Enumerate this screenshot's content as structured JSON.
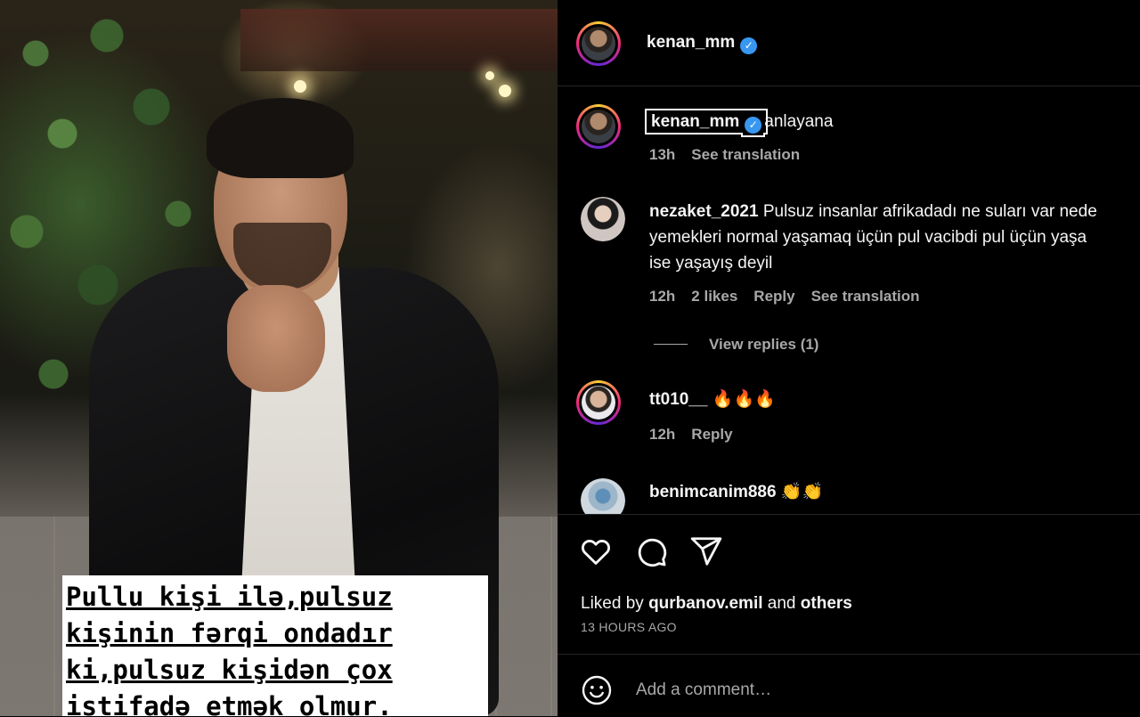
{
  "post_image": {
    "overlay_lines": [
      "Pullu kişi ilə,pulsuz",
      "kişinin fərqi ondadır",
      "ki,pulsuz kişidən çox",
      "istifadə etmək olmur."
    ]
  },
  "header": {
    "username": "kenan_mm",
    "verified_icon": "verified-badge-icon"
  },
  "caption": {
    "username": "kenan_mm",
    "text": "anlayana",
    "time": "13h",
    "see_translation": "See translation"
  },
  "comments": [
    {
      "username": "nezaket_2021",
      "line1": "Pulsuz insanlar afrikadadı ne suları var nede",
      "line2": "yemekleri normal yaşamaq üçün pul vacibdi pul üçün yaşa",
      "line3": "ise yaşayış deyil",
      "time": "12h",
      "likes": "2 likes",
      "reply": "Reply",
      "see_translation": "See translation",
      "view_replies": "View replies (1)"
    },
    {
      "username": "tt010__",
      "text": "🔥🔥🔥",
      "time": "12h",
      "reply": "Reply"
    },
    {
      "username": "benimcanim886",
      "text": "👏👏"
    }
  ],
  "actions": {
    "like_icon": "heart-icon",
    "comment_icon": "comment-icon",
    "share_icon": "send-icon"
  },
  "likes": {
    "prefix": "Liked by",
    "user": "qurbanov.emil",
    "and": "and",
    "others": "others"
  },
  "timestamp": "13 HOURS AGO",
  "composer": {
    "emoji_icon": "emoji-icon",
    "placeholder": "Add a comment…"
  },
  "colors": {
    "verified": "#3897f0",
    "muted": "#a8a8a8",
    "divider": "#262626"
  }
}
